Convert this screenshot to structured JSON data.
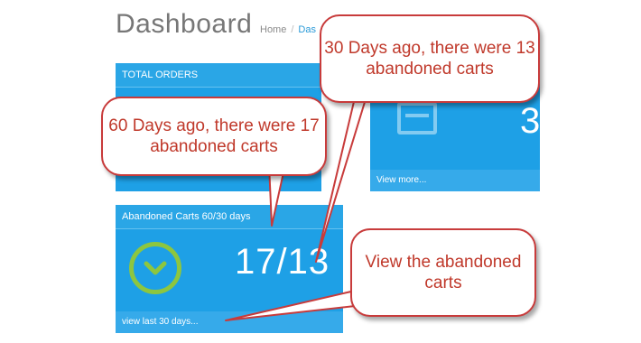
{
  "header": {
    "title": "Dashboard",
    "breadcrumb": [
      "Home",
      "Das"
    ]
  },
  "widgets": {
    "total_orders": {
      "title": "TOTAL ORDERS",
      "visible_number": "3",
      "footer": "View more..."
    },
    "abandoned_carts": {
      "title": "Abandoned Carts 60/30 days",
      "value": "17/13",
      "footer": "view last 30 days..."
    }
  },
  "callouts": {
    "days60": "60 Days ago, there were 17 abandoned carts",
    "days30": "30 Days ago, there were 13 abandoned carts",
    "view": "View the abandoned carts"
  },
  "colors": {
    "widget_blue": "#1ea0e6",
    "check_green": "#8dc63f",
    "callout_red": "#c83b3b"
  }
}
